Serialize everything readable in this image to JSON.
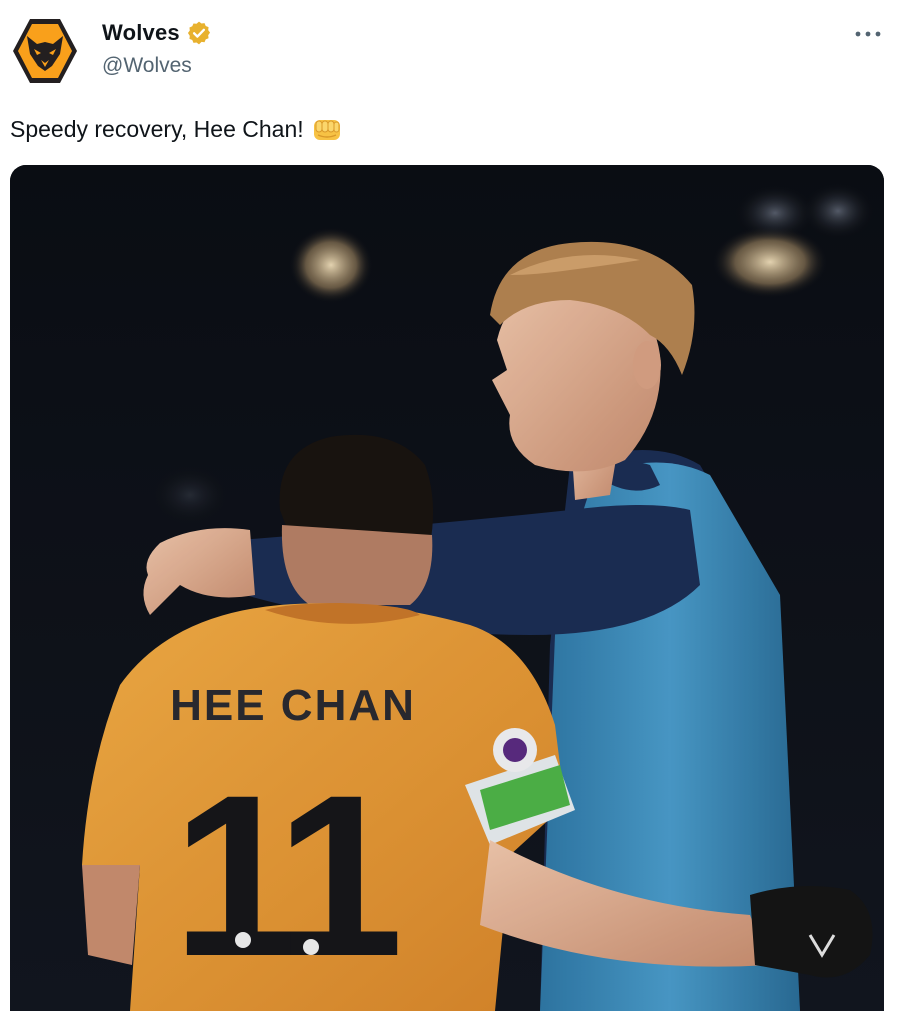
{
  "tweet": {
    "display_name": "Wolves",
    "handle": "@Wolves",
    "text": "Speedy recovery, Hee Chan!",
    "emoji": "oncoming-fist",
    "verified_badge": "gold-verified-icon",
    "more_icon": "more-horizontal-icon"
  },
  "photo": {
    "shirt_name": "HEE CHAN",
    "shirt_number": "11",
    "colors": {
      "background": "#0d0f14",
      "kit_gold": "#f0a23a",
      "bib_blue": "#3f8fbf",
      "sleeve_navy": "#1c2e55",
      "armband_green": "#4fb548"
    }
  },
  "colors": {
    "text_primary": "#0f1419",
    "text_secondary": "#536471",
    "badge_gold": "#e8b12e",
    "logo_gold": "#f9a01b",
    "logo_black": "#231f20"
  }
}
